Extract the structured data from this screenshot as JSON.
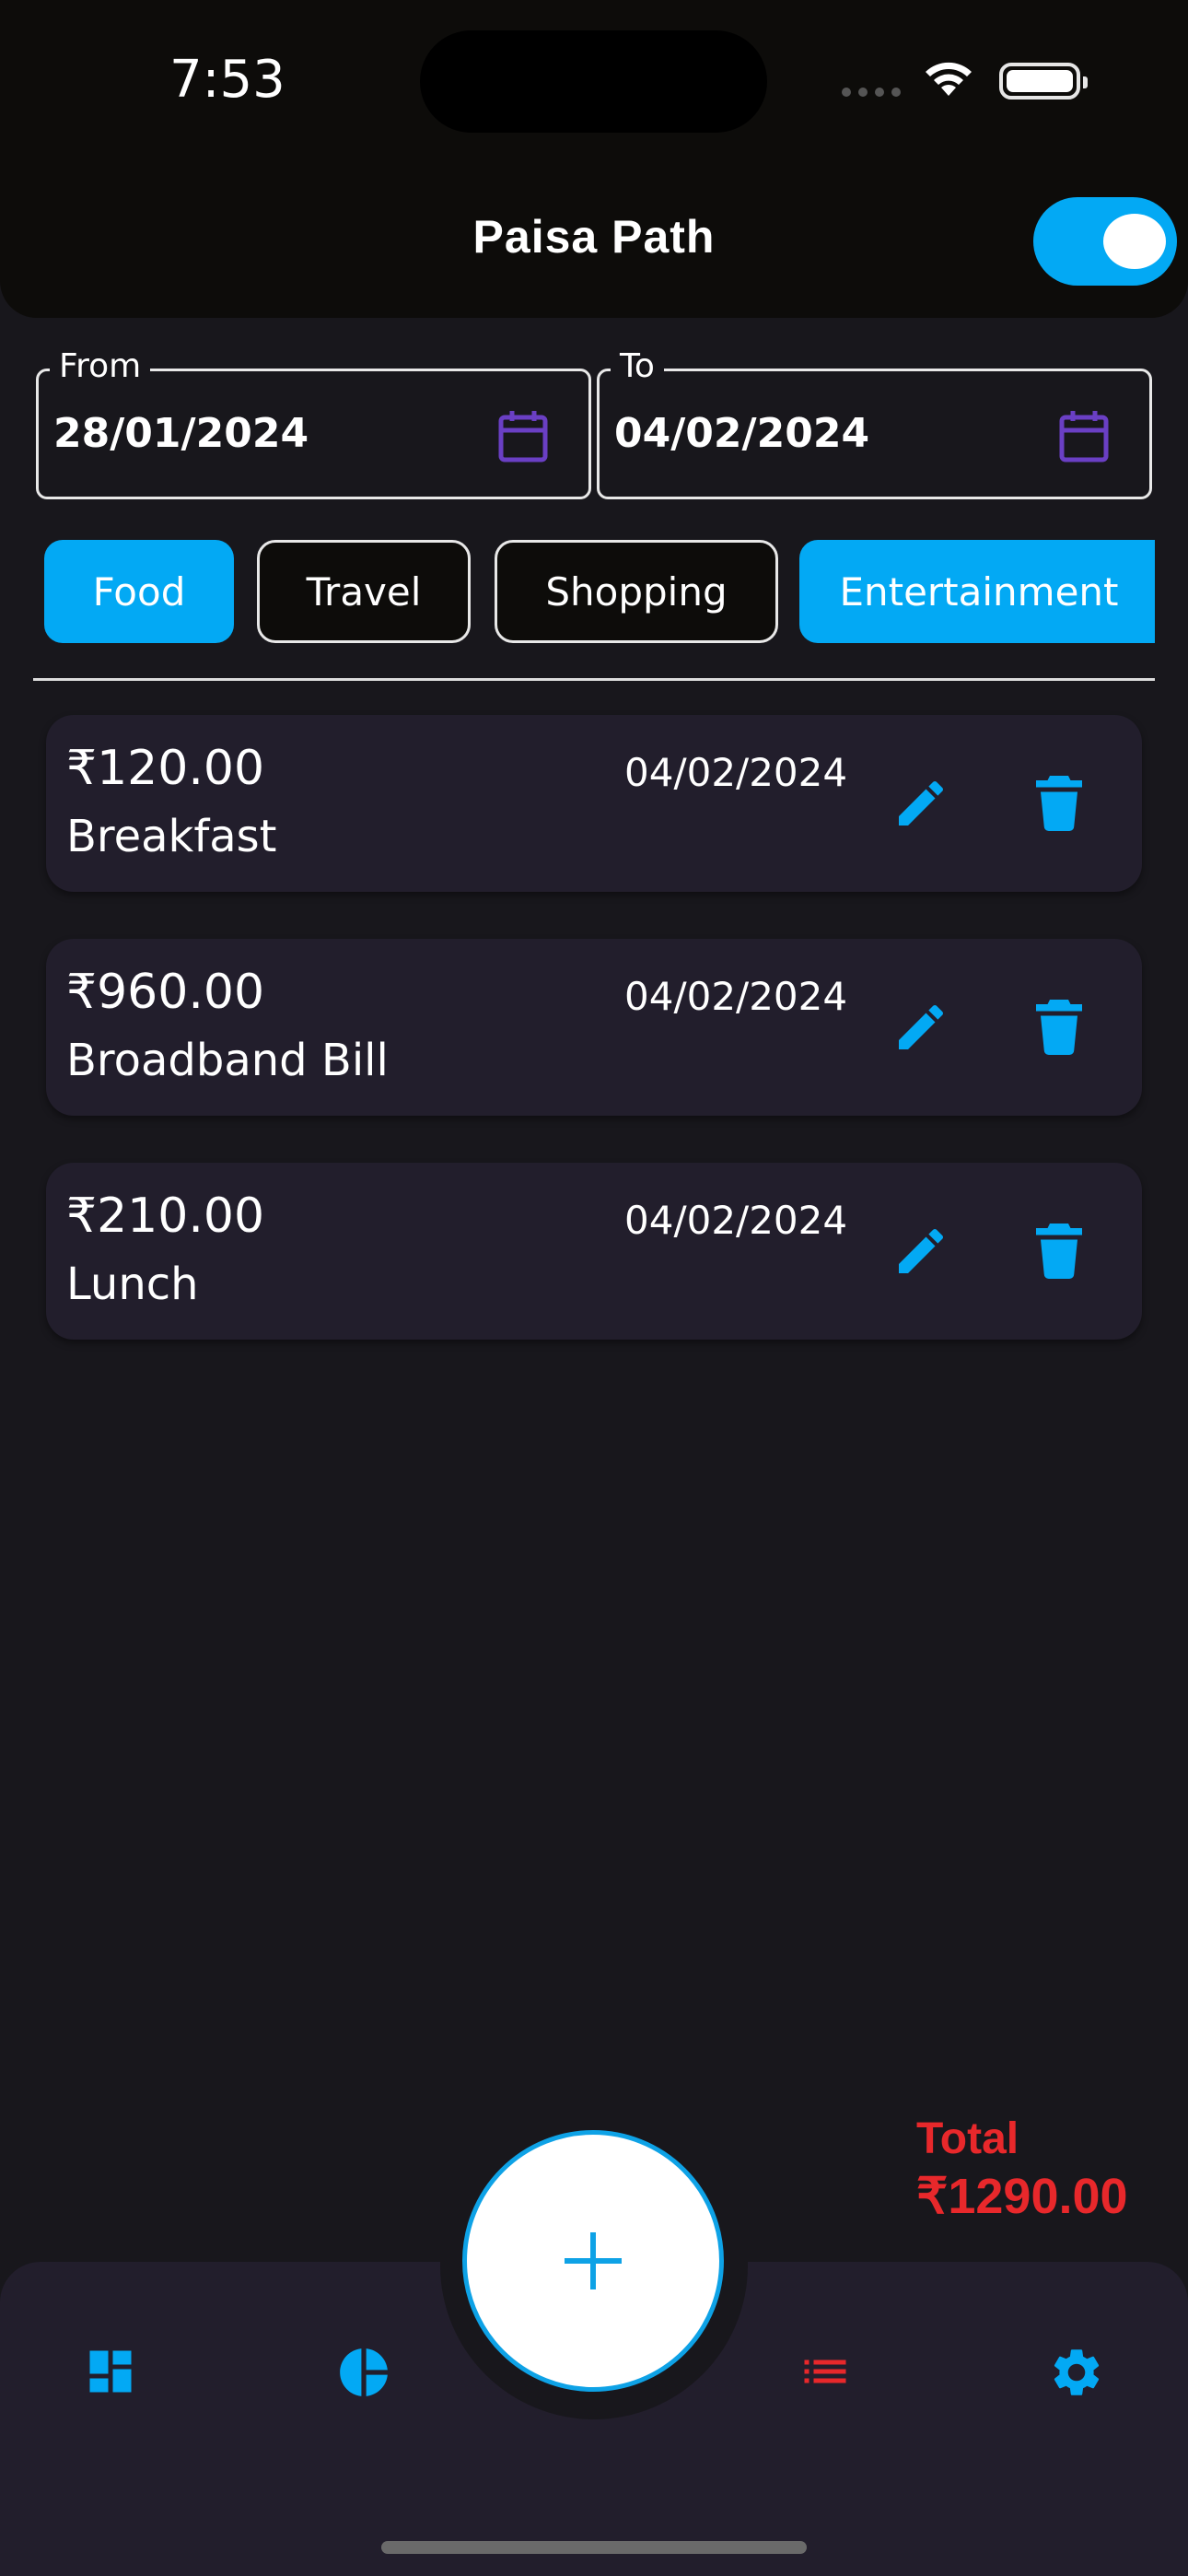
{
  "status_bar": {
    "time": "7:53"
  },
  "header": {
    "title": "Paisa Path",
    "theme_toggle_on": true
  },
  "filters": {
    "from": {
      "label": "From",
      "value": "28/01/2024"
    },
    "to": {
      "label": "To",
      "value": "04/02/2024"
    }
  },
  "categories": [
    {
      "label": "Food",
      "selected": true
    },
    {
      "label": "Travel",
      "selected": false
    },
    {
      "label": "Shopping",
      "selected": false
    },
    {
      "label": "Entertainment",
      "selected": true
    }
  ],
  "expenses": [
    {
      "amount": "₹120.00",
      "date": "04/02/2024",
      "description": "Breakfast"
    },
    {
      "amount": "₹960.00",
      "date": "04/02/2024",
      "description": "Broadband Bill"
    },
    {
      "amount": "₹210.00",
      "date": "04/02/2024",
      "description": "Lunch"
    }
  ],
  "total": {
    "label": "Total",
    "value": "₹1290.00"
  },
  "bottom_nav": {
    "items": [
      "dashboard-icon",
      "pie-chart-icon",
      "list-icon",
      "settings-icon"
    ],
    "active": "list-icon",
    "fab_icon": "plus-icon"
  },
  "colors": {
    "accent": "#03a9f4",
    "danger": "#e8282b",
    "calendar_icon": "#6a3fc4",
    "card_bg": "#221e2c",
    "page_bg": "#18171c"
  }
}
